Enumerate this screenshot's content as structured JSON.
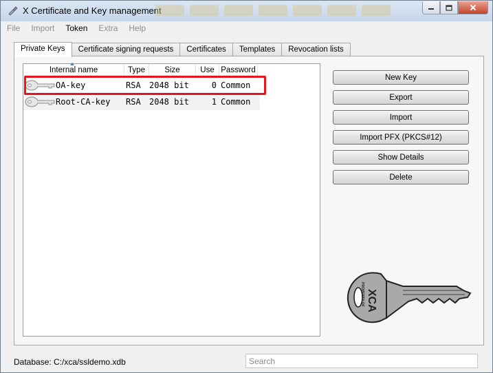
{
  "window": {
    "title": "X Certificate and Key management"
  },
  "menu": [
    "File",
    "Import",
    "Token",
    "Extra",
    "Help"
  ],
  "tabs": [
    "Private Keys",
    "Certificate signing requests",
    "Certificates",
    "Templates",
    "Revocation lists"
  ],
  "selected_tab": "Private Keys",
  "table": {
    "columns": [
      "Internal name",
      "Type",
      "Size",
      "Use",
      "Password"
    ],
    "sort_column": "Internal name",
    "rows": [
      {
        "name": "OA-key",
        "type": "RSA",
        "size": "2048 bit",
        "use": "0",
        "password": "Common",
        "highlighted": true
      },
      {
        "name": "Root-CA-key",
        "type": "RSA",
        "size": "2048 bit",
        "use": "1",
        "password": "Common",
        "highlighted": false
      }
    ]
  },
  "buttons": {
    "new_key": "New Key",
    "export": "Export",
    "import": "Import",
    "import_pfx": "Import PFX (PKCS#12)",
    "show_details": "Show Details",
    "delete": "Delete"
  },
  "key_graphic": {
    "brand_text": "XCA",
    "small_text": "PROPERTY OF"
  },
  "status": {
    "database": "Database: C:/xca/ssldemo.xdb"
  },
  "search": {
    "placeholder": "Search",
    "value": ""
  },
  "colors": {
    "highlight": "#e8131b",
    "window_frame": "#c5d6ea",
    "key_gray": "#a9a9a9"
  }
}
